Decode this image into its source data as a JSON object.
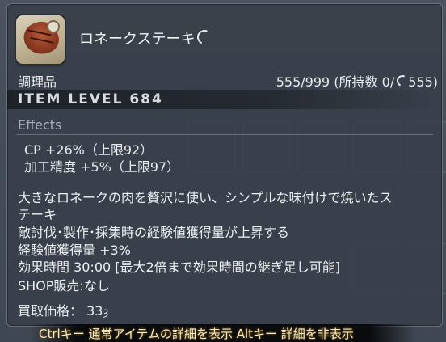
{
  "item": {
    "name": "ロネークステーキ",
    "icon": "steak-icon",
    "hq_icon": "hq-icon",
    "category": "調理品",
    "stack_text": "555/999 (所持数 0/",
    "stack_hq": "555)",
    "item_level": "ITEM LEVEL 684"
  },
  "effects": {
    "heading": "Effects",
    "lines": [
      "CP +26%（上限92）",
      "加工精度 +5%（上限97）"
    ]
  },
  "description": {
    "lines": [
      "大きなロネークの肉を贅沢に使い、シンプルな味付けで焼いたス",
      "テーキ",
      "敵討伐･製作･採集時の経験値獲得量が上昇する",
      "経験値獲得量 +3%",
      "効果時間 30:00 [最大2倍まで効果時間の継ぎ足し可能]",
      "SHOP販売:なし"
    ]
  },
  "price": {
    "label": "買取価格：",
    "value": "33",
    "currency": "ȝ"
  },
  "hints": {
    "text": "Ctrlキー 通常アイテムの詳細を表示 Altキー 詳細を非表示"
  }
}
